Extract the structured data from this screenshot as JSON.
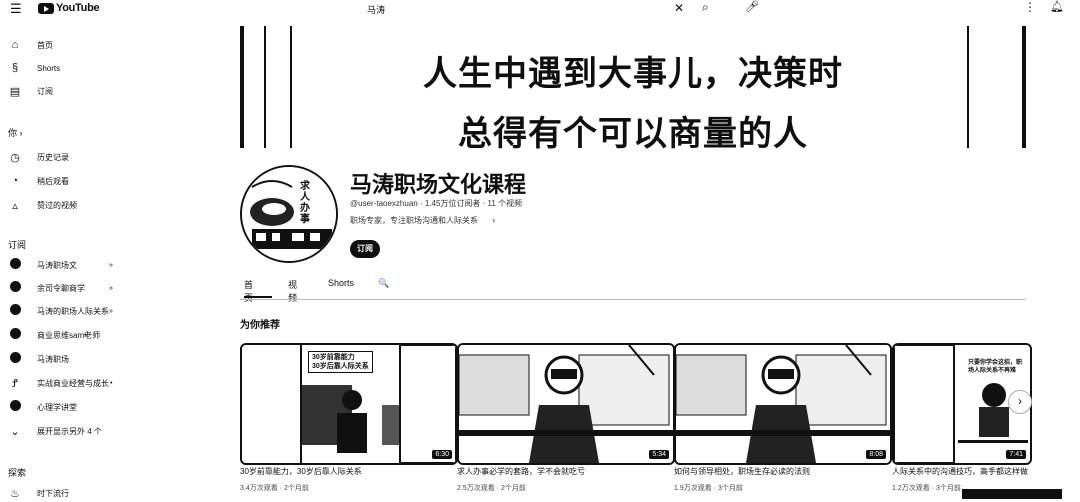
{
  "topbar": {
    "menu_icon": "menu-icon",
    "logo_text": "YouTube",
    "search_value": "马涛",
    "clear_icon": "✕",
    "search_icon": "search-icon",
    "mic_icon": "microphone-icon",
    "more_icon": "more-vert-icon",
    "bell_icon": "bell-icon"
  },
  "sidebar": {
    "main": [
      {
        "icon": "home-icon",
        "glyph": "⌂",
        "label": "首页"
      },
      {
        "icon": "shorts-icon",
        "glyph": "§",
        "label": "Shorts"
      },
      {
        "icon": "subscriptions-icon",
        "glyph": "▤",
        "label": "订阅"
      }
    ],
    "you_header": "你 ›",
    "you": [
      {
        "icon": "history-icon",
        "glyph": "◷",
        "label": "历史记录"
      },
      {
        "icon": "watch-later-icon",
        "glyph": "◔",
        "label": "稍后观看"
      },
      {
        "icon": "liked-icon",
        "glyph": "👍",
        "label": "赞过的视频"
      }
    ],
    "subs_header": "订阅",
    "subs": [
      {
        "label": "马涛职场文",
        "dot": "»"
      },
      {
        "label": "余司令聊商学",
        "dot": "»"
      },
      {
        "label": "马涛的职场人际关系",
        "dot": "»"
      },
      {
        "label": "商业思维sam老师",
        "dot": "•"
      },
      {
        "label": "马涛职场",
        "dot": ""
      },
      {
        "label": "实战商业经营与成长",
        "dot": "•"
      },
      {
        "label": "心理学讲堂",
        "dot": ""
      },
      {
        "label": "展开显示另外 4 个",
        "dot": ""
      }
    ],
    "explore_header": "探索",
    "explore": [
      {
        "label": "时下流行",
        "glyph": "🔥"
      }
    ]
  },
  "banner": {
    "line1": "人生中遇到大事儿，决策时",
    "line2": "总得有个可以商量的人"
  },
  "channel": {
    "name": "马涛职场文化课程",
    "meta": "@user-taoexzhuan · 1.45万位订阅者 · 11 个视频",
    "description": "职场专家，专注职场沟通和人际关系",
    "description_more": "›",
    "subscribe_label": "订阅",
    "avatar_text": "求人办事"
  },
  "tabs": [
    {
      "label": "首页"
    },
    {
      "label": "视频"
    },
    {
      "label": "Shorts"
    },
    {
      "label": "🔍"
    }
  ],
  "section_title": "为你推荐",
  "videos": [
    {
      "title": "30岁前靠能力，30岁后靠人际关系",
      "meta": "3.4万次观看 · 2个月前",
      "caption_line1": "30岁前靠能力",
      "caption_line2": "30岁后靠人际关系",
      "duration": "6:30"
    },
    {
      "title": "求人办事必学的套路，学不会就吃亏",
      "meta": "2.5万次观看 · 2个月前",
      "duration": "5:34"
    },
    {
      "title": "如何与领导相处，职场生存必读的法则",
      "meta": "1.9万次观看 · 3个月前",
      "duration": "8:08"
    },
    {
      "title": "人际关系中的沟通技巧，高手都这样做",
      "meta": "1.2万次观看 · 3个月前",
      "caption": "只要你学会这招，职场人际关系不再难",
      "duration": "7:41"
    }
  ],
  "colors": {
    "background": "#ffffff",
    "text": "#0f0f0f",
    "button": "#0f0f0f"
  }
}
